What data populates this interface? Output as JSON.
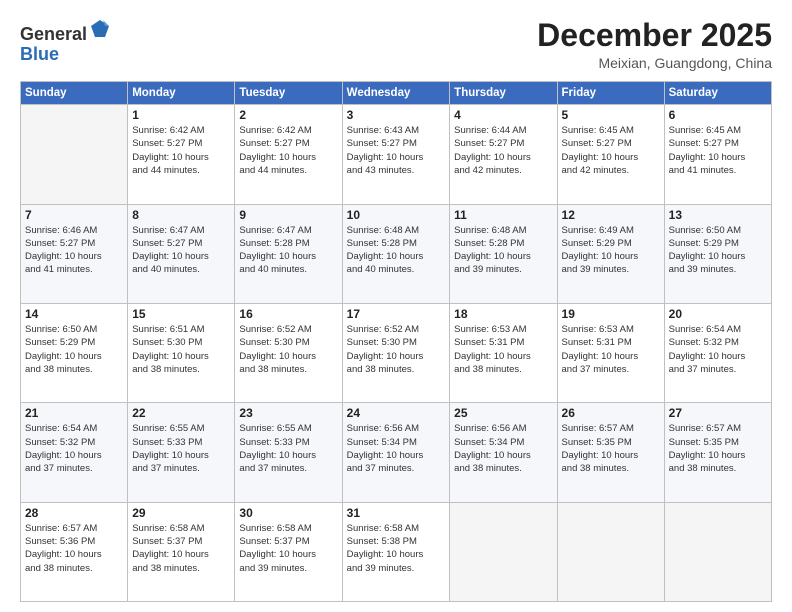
{
  "logo": {
    "general": "General",
    "blue": "Blue"
  },
  "header": {
    "month": "December 2025",
    "location": "Meixian, Guangdong, China"
  },
  "days_of_week": [
    "Sunday",
    "Monday",
    "Tuesday",
    "Wednesday",
    "Thursday",
    "Friday",
    "Saturday"
  ],
  "weeks": [
    [
      {
        "day": "",
        "sunrise": "",
        "sunset": "",
        "daylight": ""
      },
      {
        "day": "1",
        "sunrise": "Sunrise: 6:42 AM",
        "sunset": "Sunset: 5:27 PM",
        "daylight": "Daylight: 10 hours and 44 minutes."
      },
      {
        "day": "2",
        "sunrise": "Sunrise: 6:42 AM",
        "sunset": "Sunset: 5:27 PM",
        "daylight": "Daylight: 10 hours and 44 minutes."
      },
      {
        "day": "3",
        "sunrise": "Sunrise: 6:43 AM",
        "sunset": "Sunset: 5:27 PM",
        "daylight": "Daylight: 10 hours and 43 minutes."
      },
      {
        "day": "4",
        "sunrise": "Sunrise: 6:44 AM",
        "sunset": "Sunset: 5:27 PM",
        "daylight": "Daylight: 10 hours and 42 minutes."
      },
      {
        "day": "5",
        "sunrise": "Sunrise: 6:45 AM",
        "sunset": "Sunset: 5:27 PM",
        "daylight": "Daylight: 10 hours and 42 minutes."
      },
      {
        "day": "6",
        "sunrise": "Sunrise: 6:45 AM",
        "sunset": "Sunset: 5:27 PM",
        "daylight": "Daylight: 10 hours and 41 minutes."
      }
    ],
    [
      {
        "day": "7",
        "sunrise": "Sunrise: 6:46 AM",
        "sunset": "Sunset: 5:27 PM",
        "daylight": "Daylight: 10 hours and 41 minutes."
      },
      {
        "day": "8",
        "sunrise": "Sunrise: 6:47 AM",
        "sunset": "Sunset: 5:27 PM",
        "daylight": "Daylight: 10 hours and 40 minutes."
      },
      {
        "day": "9",
        "sunrise": "Sunrise: 6:47 AM",
        "sunset": "Sunset: 5:28 PM",
        "daylight": "Daylight: 10 hours and 40 minutes."
      },
      {
        "day": "10",
        "sunrise": "Sunrise: 6:48 AM",
        "sunset": "Sunset: 5:28 PM",
        "daylight": "Daylight: 10 hours and 40 minutes."
      },
      {
        "day": "11",
        "sunrise": "Sunrise: 6:48 AM",
        "sunset": "Sunset: 5:28 PM",
        "daylight": "Daylight: 10 hours and 39 minutes."
      },
      {
        "day": "12",
        "sunrise": "Sunrise: 6:49 AM",
        "sunset": "Sunset: 5:29 PM",
        "daylight": "Daylight: 10 hours and 39 minutes."
      },
      {
        "day": "13",
        "sunrise": "Sunrise: 6:50 AM",
        "sunset": "Sunset: 5:29 PM",
        "daylight": "Daylight: 10 hours and 39 minutes."
      }
    ],
    [
      {
        "day": "14",
        "sunrise": "Sunrise: 6:50 AM",
        "sunset": "Sunset: 5:29 PM",
        "daylight": "Daylight: 10 hours and 38 minutes."
      },
      {
        "day": "15",
        "sunrise": "Sunrise: 6:51 AM",
        "sunset": "Sunset: 5:30 PM",
        "daylight": "Daylight: 10 hours and 38 minutes."
      },
      {
        "day": "16",
        "sunrise": "Sunrise: 6:52 AM",
        "sunset": "Sunset: 5:30 PM",
        "daylight": "Daylight: 10 hours and 38 minutes."
      },
      {
        "day": "17",
        "sunrise": "Sunrise: 6:52 AM",
        "sunset": "Sunset: 5:30 PM",
        "daylight": "Daylight: 10 hours and 38 minutes."
      },
      {
        "day": "18",
        "sunrise": "Sunrise: 6:53 AM",
        "sunset": "Sunset: 5:31 PM",
        "daylight": "Daylight: 10 hours and 38 minutes."
      },
      {
        "day": "19",
        "sunrise": "Sunrise: 6:53 AM",
        "sunset": "Sunset: 5:31 PM",
        "daylight": "Daylight: 10 hours and 37 minutes."
      },
      {
        "day": "20",
        "sunrise": "Sunrise: 6:54 AM",
        "sunset": "Sunset: 5:32 PM",
        "daylight": "Daylight: 10 hours and 37 minutes."
      }
    ],
    [
      {
        "day": "21",
        "sunrise": "Sunrise: 6:54 AM",
        "sunset": "Sunset: 5:32 PM",
        "daylight": "Daylight: 10 hours and 37 minutes."
      },
      {
        "day": "22",
        "sunrise": "Sunrise: 6:55 AM",
        "sunset": "Sunset: 5:33 PM",
        "daylight": "Daylight: 10 hours and 37 minutes."
      },
      {
        "day": "23",
        "sunrise": "Sunrise: 6:55 AM",
        "sunset": "Sunset: 5:33 PM",
        "daylight": "Daylight: 10 hours and 37 minutes."
      },
      {
        "day": "24",
        "sunrise": "Sunrise: 6:56 AM",
        "sunset": "Sunset: 5:34 PM",
        "daylight": "Daylight: 10 hours and 37 minutes."
      },
      {
        "day": "25",
        "sunrise": "Sunrise: 6:56 AM",
        "sunset": "Sunset: 5:34 PM",
        "daylight": "Daylight: 10 hours and 38 minutes."
      },
      {
        "day": "26",
        "sunrise": "Sunrise: 6:57 AM",
        "sunset": "Sunset: 5:35 PM",
        "daylight": "Daylight: 10 hours and 38 minutes."
      },
      {
        "day": "27",
        "sunrise": "Sunrise: 6:57 AM",
        "sunset": "Sunset: 5:35 PM",
        "daylight": "Daylight: 10 hours and 38 minutes."
      }
    ],
    [
      {
        "day": "28",
        "sunrise": "Sunrise: 6:57 AM",
        "sunset": "Sunset: 5:36 PM",
        "daylight": "Daylight: 10 hours and 38 minutes."
      },
      {
        "day": "29",
        "sunrise": "Sunrise: 6:58 AM",
        "sunset": "Sunset: 5:37 PM",
        "daylight": "Daylight: 10 hours and 38 minutes."
      },
      {
        "day": "30",
        "sunrise": "Sunrise: 6:58 AM",
        "sunset": "Sunset: 5:37 PM",
        "daylight": "Daylight: 10 hours and 39 minutes."
      },
      {
        "day": "31",
        "sunrise": "Sunrise: 6:58 AM",
        "sunset": "Sunset: 5:38 PM",
        "daylight": "Daylight: 10 hours and 39 minutes."
      },
      {
        "day": "",
        "sunrise": "",
        "sunset": "",
        "daylight": ""
      },
      {
        "day": "",
        "sunrise": "",
        "sunset": "",
        "daylight": ""
      },
      {
        "day": "",
        "sunrise": "",
        "sunset": "",
        "daylight": ""
      }
    ]
  ]
}
